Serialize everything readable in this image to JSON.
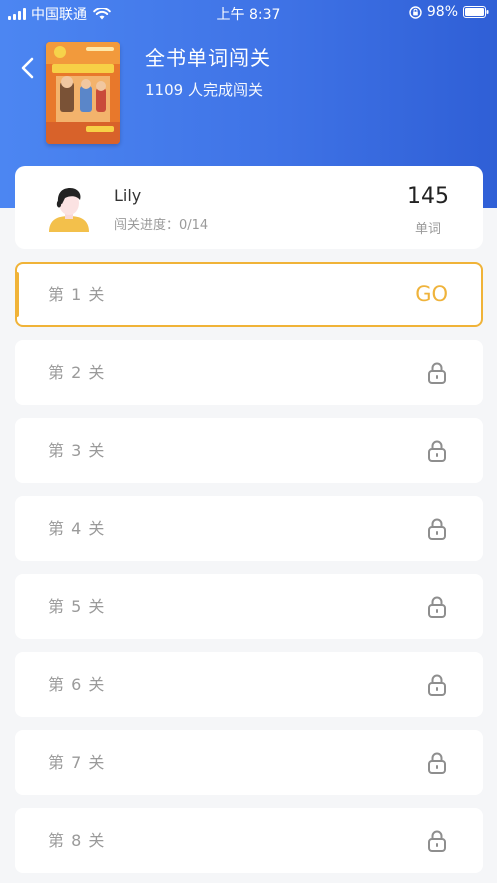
{
  "status_bar": {
    "carrier": "中国联通",
    "time": "上午 8:37",
    "battery": "98%"
  },
  "header": {
    "title": "全书单词闯关",
    "subtitle": "1109 人完成闯关",
    "back_icon": "chevron-left-icon",
    "cover_icon": "book-cover-image"
  },
  "user": {
    "name": "Lily",
    "progress": "闯关进度：0/14",
    "word_count": "145",
    "word_label": "单词"
  },
  "levels": [
    {
      "label": "第 1 关",
      "action": "GO",
      "locked": false
    },
    {
      "label": "第 2 关",
      "locked": true
    },
    {
      "label": "第 3 关",
      "locked": true
    },
    {
      "label": "第 4 关",
      "locked": true
    },
    {
      "label": "第 5 关",
      "locked": true
    },
    {
      "label": "第 6 关",
      "locked": true
    },
    {
      "label": "第 7 关",
      "locked": true
    },
    {
      "label": "第 8 关",
      "locked": true
    }
  ],
  "colors": {
    "header_blue": "#3f73e6",
    "accent_orange": "#f0b338",
    "muted_text": "#9a9a9a"
  }
}
